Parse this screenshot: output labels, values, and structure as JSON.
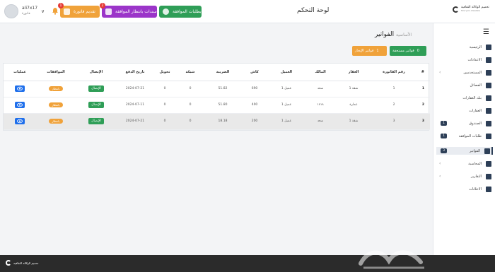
{
  "header": {
    "title": "لوحة التحكم",
    "user": {
      "name": "ali7x17",
      "role": "فاتورة"
    },
    "buttons": {
      "orange": {
        "label": "تقديم فاتورة",
        "badge": "1"
      },
      "purple": {
        "label": "سندات بانتظار الموافقة",
        "badge": "2"
      },
      "green": {
        "label": "بطلبات الموافقة"
      }
    },
    "logo": {
      "text": "تحميم الوكالة الثقافية",
      "sub": "Mou'jam Alwakala"
    }
  },
  "sidebar": {
    "items": [
      {
        "label": "الرئيسية",
        "icon": "home-icon"
      },
      {
        "label": "الاعدادات",
        "icon": "gear-icon"
      },
      {
        "label": "المستخدمين",
        "icon": "users-icon"
      },
      {
        "label": "الفصائل",
        "icon": "group-icon"
      },
      {
        "label": "بنك العقارات",
        "icon": "building-icon"
      },
      {
        "label": "العقارات",
        "icon": "house-icon"
      },
      {
        "label": "الصندوق",
        "icon": "box-icon",
        "count": "1"
      },
      {
        "label": "طلبات الموافقة",
        "icon": "check-icon",
        "count": "1"
      },
      {
        "label": "الفواتير",
        "icon": "invoice-icon",
        "count": "3"
      },
      {
        "label": "المحاسبة",
        "icon": "calculator-icon"
      },
      {
        "label": "التقارير",
        "icon": "report-icon"
      },
      {
        "label": "الاعلانات",
        "icon": "megaphone-icon"
      }
    ]
  },
  "main": {
    "breadcrumb": {
      "home": "الأساسية",
      "current": "الفواتير"
    },
    "actions": {
      "green": {
        "label": "فواتير مستحقة",
        "count": "0"
      },
      "orange": {
        "label": "فواتير الإيجار",
        "count": "1"
      }
    },
    "table": {
      "headers": [
        "عمليات",
        "الموافقات",
        "الإيصال",
        "تاريخ الدفع",
        "تحويل",
        "شبكة",
        "الضريبة",
        "كاش",
        "العميل",
        "المالك",
        "العقار",
        "رقم الفاتورة",
        "#"
      ],
      "rows": [
        {
          "ops": "",
          "approval": "بانتظار",
          "receipt": "الإيصال",
          "date": "2024-07-21",
          "transfer": "0",
          "network": "0",
          "tax": "51.82",
          "cash": "690",
          "client": "عميل 1",
          "owner": "سعد",
          "property": "شقة 1",
          "invoice": "1",
          "idx": "1"
        },
        {
          "ops": "",
          "approval": "بانتظار",
          "receipt": "الإيصال",
          "date": "2024-07-11",
          "transfer": "0",
          "network": "0",
          "tax": "51.80",
          "cash": "400",
          "client": "عميل 1",
          "owner": "١٨١٨",
          "property": "عمارة",
          "invoice": "2",
          "idx": "2"
        },
        {
          "ops": "",
          "approval": "بانتظار",
          "receipt": "الإيصال",
          "date": "2024-07-21",
          "transfer": "0",
          "network": "0",
          "tax": "18.18",
          "cash": "200",
          "client": "عميل 1",
          "owner": "سعد",
          "property": "شقة 1",
          "invoice": "3",
          "idx": "3"
        }
      ]
    }
  },
  "footer": {
    "logo_text": "تحميم الوكالة الثقافية"
  },
  "colors": {
    "green": "#2f9e57",
    "orange": "#f0a23a",
    "purple": "#9b35c9",
    "blue": "#1f6feb",
    "navy": "#2d3f57"
  }
}
